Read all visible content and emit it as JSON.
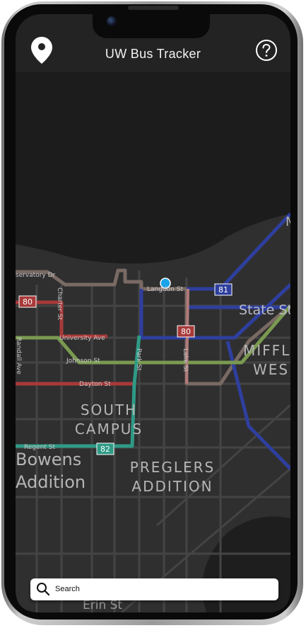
{
  "app": {
    "title": "UW Bus Tracker"
  },
  "header": {
    "left_icon": "location-pin-icon",
    "right_icon": "help-circle-icon"
  },
  "map": {
    "streets": {
      "observatory": "servatory Dr",
      "charter": "Charter St",
      "langdon": "Langdon St",
      "university": "University Ave",
      "randall": "Randall Ave",
      "johnson": "Johnson St",
      "park": "Park St",
      "lake": "Lake St",
      "dayton": "Dayton St",
      "regent": "Regent St",
      "state": "State St",
      "erin": "Erin St"
    },
    "areas": {
      "south_campus_1": "SOUTH",
      "south_campus_2": "CAMPUS",
      "bowens_1": "Bowens",
      "bowens_2": "Addition",
      "preglers_1": "PREGLERS",
      "preglers_2": "ADDITION",
      "mifflin": "MIFFL",
      "west": "WES",
      "corner": "M"
    },
    "route_badges": {
      "r80_left": "80",
      "r80_mid": "80",
      "r81": "81",
      "r82": "82"
    },
    "colors": {
      "route_80": "#a83a3a",
      "route_81": "#2e3f9e",
      "route_82": "#2f9a86",
      "route_green": "#7a9a50",
      "route_pink": "#b07a7a",
      "user_location": "#1aa3e8"
    }
  },
  "search": {
    "label": "Search",
    "icon": "search-icon"
  }
}
